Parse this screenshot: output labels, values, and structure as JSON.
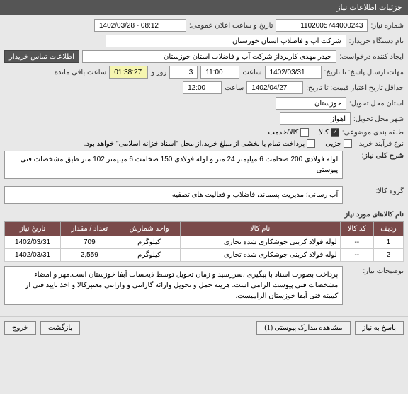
{
  "header": {
    "title": "جزئیات اطلاعات نیاز"
  },
  "fields": {
    "need_no_label": "شماره نیاز:",
    "need_no": "1102005744000243",
    "pub_datetime_label": "تاریخ و ساعت اعلان عمومی:",
    "pub_datetime": "1402/03/28 - 08:12",
    "buyer_label": "نام دستگاه خریدار:",
    "buyer": "شرکت آب و فاضلاب استان خوزستان",
    "creator_label": "ایجاد کننده درخواست:",
    "creator": "حیدر مهدی کارپرداز شرکت آب و فاضلاب استان خوزستان",
    "buyer_contact_btn": "اطلاعات تماس خریدار",
    "min_reply_label": "مهلت ارسال پاسخ: تا تاریخ:",
    "min_reply_date": "1402/03/31",
    "time_label": "ساعت",
    "min_reply_time": "11:00",
    "min_reply_days": "3",
    "days_and": "روز و",
    "remain_time": "01:38:27",
    "remain_label": "ساعت باقی مانده",
    "validity_label": "حداقل تاریخ اعتبار قیمت: تا تاریخ:",
    "validity_date": "1402/04/27",
    "validity_time": "12:00",
    "province_label": "استان محل تحویل:",
    "province": "خوزستان",
    "city_label": "شهر محل تحویل:",
    "city": "اهواز",
    "topic_label": "طبقه بندی موضوعی:",
    "topic_goods": "کالا",
    "topic_service": "کالا/خدمت",
    "buy_type_label": "نوع فرآیند خرید :",
    "buy_type_partial": "جزیی",
    "buy_type_note": "پرداخت تمام یا بخشی از مبلغ خرید،از محل \"اسناد خزانه اسلامی\" خواهد بود.",
    "general_label": "شرح کلی نیاز:",
    "general_desc": "لوله فولادی 200 ضخامت 6 میلیمتر 24 متر و لوله فولادی 150 ضخامت 6 میلیمتر 102 متر طبق مشخصات فنی پیوستی",
    "group_label": "گروه کالا:",
    "group": "آب رسانی؛ مدیریت پسماند، فاضلاب و فعالیت های تصفیه",
    "items_label": "نام کالاهای مورد نیاز",
    "notes_label": "توضیحات نیاز:",
    "notes": "پرداخت بصورت اسناد با پیگیری ،سررسید و زمان تحویل توسط ذیحساب آبفا خوزستان است.مهر و امضاء مشخصات فنی پیوست الزامی است. هزینه حمل و تحویل وارائه گارانتی و وارانتی معتبرکالا و اخذ تایید فنی از کمیته فنی آبفا خوزستان الزامیست."
  },
  "table": {
    "headers": {
      "row": "ردیف",
      "code": "کد کالا",
      "name": "نام کالا",
      "unit": "واحد شمارش",
      "qty": "تعداد / مقدار",
      "date": "تاریخ نیاز"
    },
    "rows": [
      {
        "row": "1",
        "code": "--",
        "name": "لوله فولاد کربنی جوشکاری شده تجاری",
        "unit": "کیلوگرم",
        "qty": "709",
        "date": "1402/03/31"
      },
      {
        "row": "2",
        "code": "--",
        "name": "لوله فولاد کربنی جوشکاری شده تجاری",
        "unit": "کیلوگرم",
        "qty": "2,559",
        "date": "1402/03/31"
      }
    ]
  },
  "footer": {
    "reply": "پاسخ به نیاز",
    "attachments": "مشاهده مدارک پیوستی (1)",
    "back": "بازگشت",
    "exit": "خروج"
  }
}
